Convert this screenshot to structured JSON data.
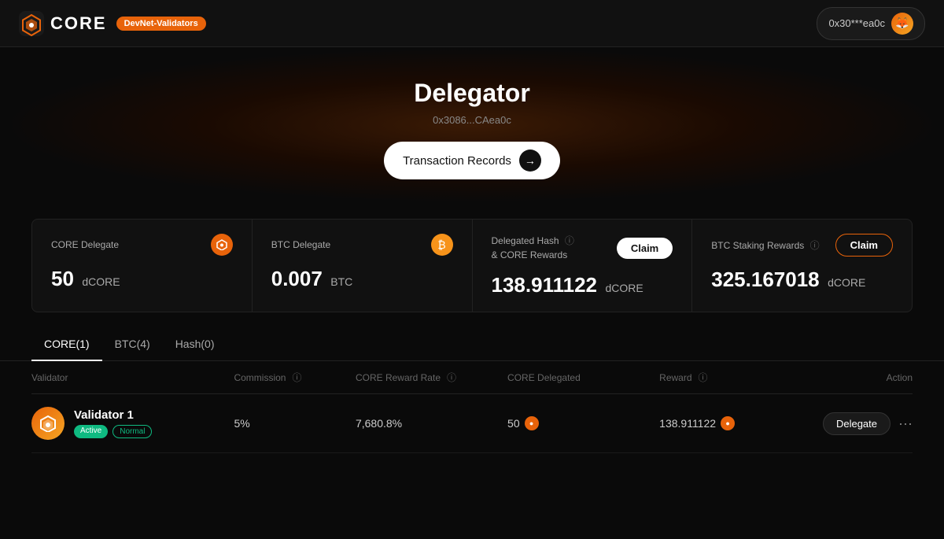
{
  "navbar": {
    "logo_text": "CORE",
    "network_badge": "DevNet-Validators",
    "wallet_address": "0x30***ea0c",
    "wallet_emoji": "🦊"
  },
  "hero": {
    "title": "Delegator",
    "address": "0x3086...CAea0c",
    "tx_records_label": "Transaction Records"
  },
  "stats": {
    "core_delegate": {
      "label": "CORE Delegate",
      "value": "50",
      "unit": "dCORE"
    },
    "btc_delegate": {
      "label": "BTC Delegate",
      "value": "0.007",
      "unit": "BTC"
    },
    "delegated_hash": {
      "label": "Delegated Hash",
      "label2": "& CORE Rewards",
      "value": "138.911122",
      "unit": "dCORE",
      "claim_label": "Claim"
    },
    "btc_staking": {
      "label": "BTC Staking Rewards",
      "value": "325.167018",
      "unit": "dCORE",
      "claim_label": "Claim"
    }
  },
  "tabs": [
    {
      "label": "CORE(1)",
      "active": true
    },
    {
      "label": "BTC(4)",
      "active": false
    },
    {
      "label": "Hash(0)",
      "active": false
    }
  ],
  "table": {
    "headers": [
      {
        "label": "Validator",
        "has_info": false
      },
      {
        "label": "Commission",
        "has_info": true
      },
      {
        "label": "CORE Reward Rate",
        "has_info": true
      },
      {
        "label": "CORE Delegated",
        "has_info": false
      },
      {
        "label": "Reward",
        "has_info": true
      },
      {
        "label": "Action",
        "has_info": false
      }
    ],
    "rows": [
      {
        "validator_name": "Validator 1",
        "status_active": "Active",
        "status_normal": "Normal",
        "commission": "5%",
        "reward_rate": "7,680.8%",
        "core_delegated": "50",
        "reward": "138.911122",
        "delegate_label": "Delegate",
        "more_label": "···"
      }
    ]
  }
}
